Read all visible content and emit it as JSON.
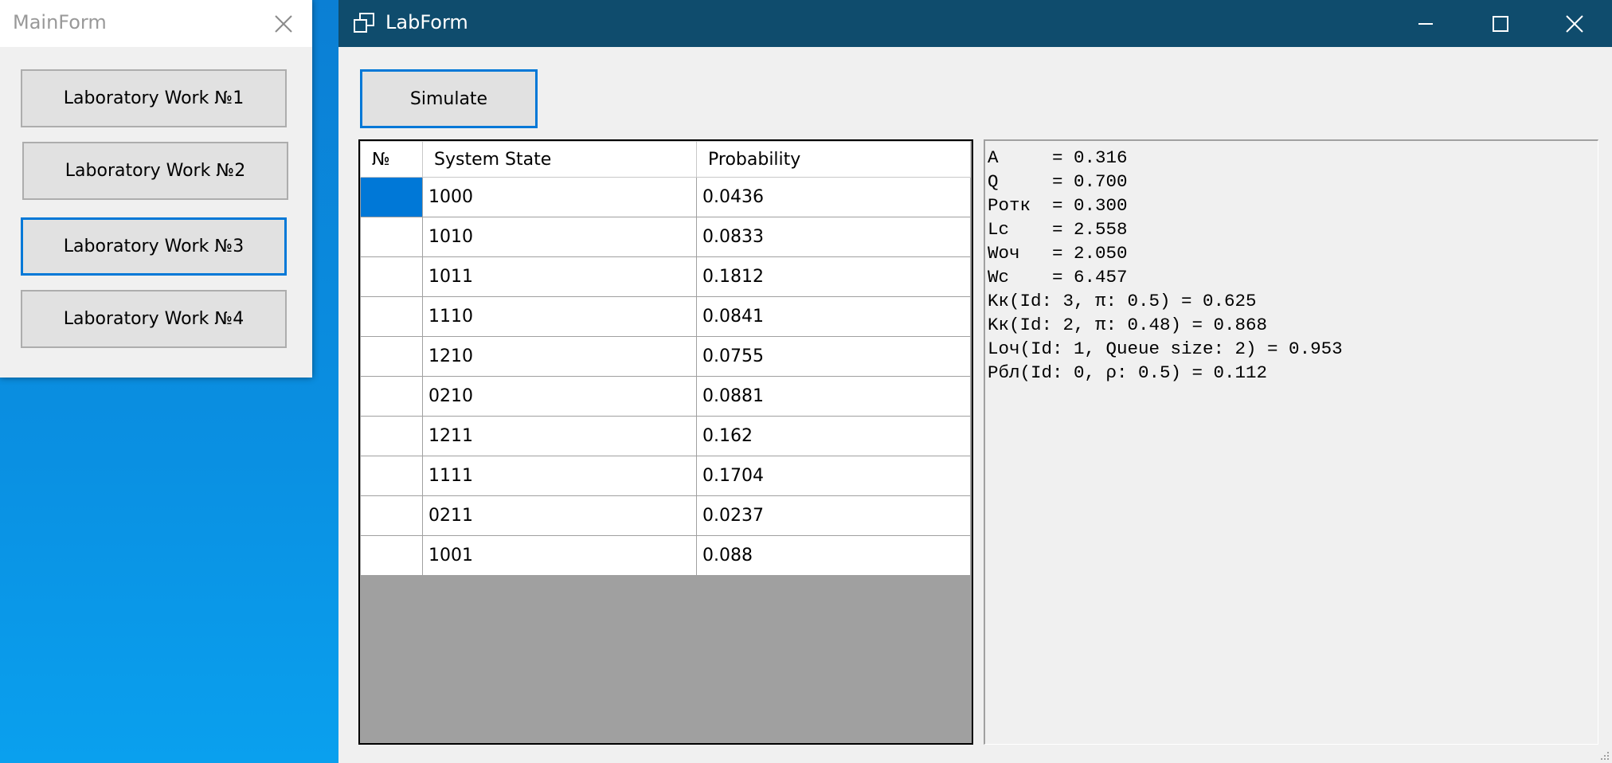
{
  "main_form": {
    "title": "MainForm",
    "buttons": [
      {
        "label": "Laboratory Work №1"
      },
      {
        "label": "Laboratory Work №2"
      },
      {
        "label": "Laboratory Work №3"
      },
      {
        "label": "Laboratory Work №4"
      }
    ]
  },
  "lab_form": {
    "title": "LabForm",
    "simulate_label": "Simulate",
    "table": {
      "columns": [
        "№",
        "System State",
        "Probability"
      ],
      "rows": [
        {
          "state": "1000",
          "probability": "0.0436"
        },
        {
          "state": "1010",
          "probability": "0.0833"
        },
        {
          "state": "1011",
          "probability": "0.1812"
        },
        {
          "state": "1110",
          "probability": "0.0841"
        },
        {
          "state": "1210",
          "probability": "0.0755"
        },
        {
          "state": "0210",
          "probability": "0.0881"
        },
        {
          "state": "1211",
          "probability": "0.162"
        },
        {
          "state": "1111",
          "probability": "0.1704"
        },
        {
          "state": "0211",
          "probability": "0.0237"
        },
        {
          "state": "1001",
          "probability": "0.088"
        }
      ]
    },
    "results": [
      "A     = 0.316",
      "Q     = 0.700",
      "Ротк  = 0.300",
      "Lc    = 2.558",
      "Wоч   = 2.050",
      "Wc    = 6.457",
      "Kк(Id: 3, π: 0.5) = 0.625",
      "Kк(Id: 2, π: 0.48) = 0.868",
      "Lоч(Id: 1, Queue size: 2) = 0.953",
      "Рбл(Id: 0, ρ: 0.5) = 0.112"
    ]
  },
  "colors": {
    "titlebar_active": "#0f4c6d",
    "focus_accent": "#0078d7",
    "desktop": "#0a84d6"
  }
}
